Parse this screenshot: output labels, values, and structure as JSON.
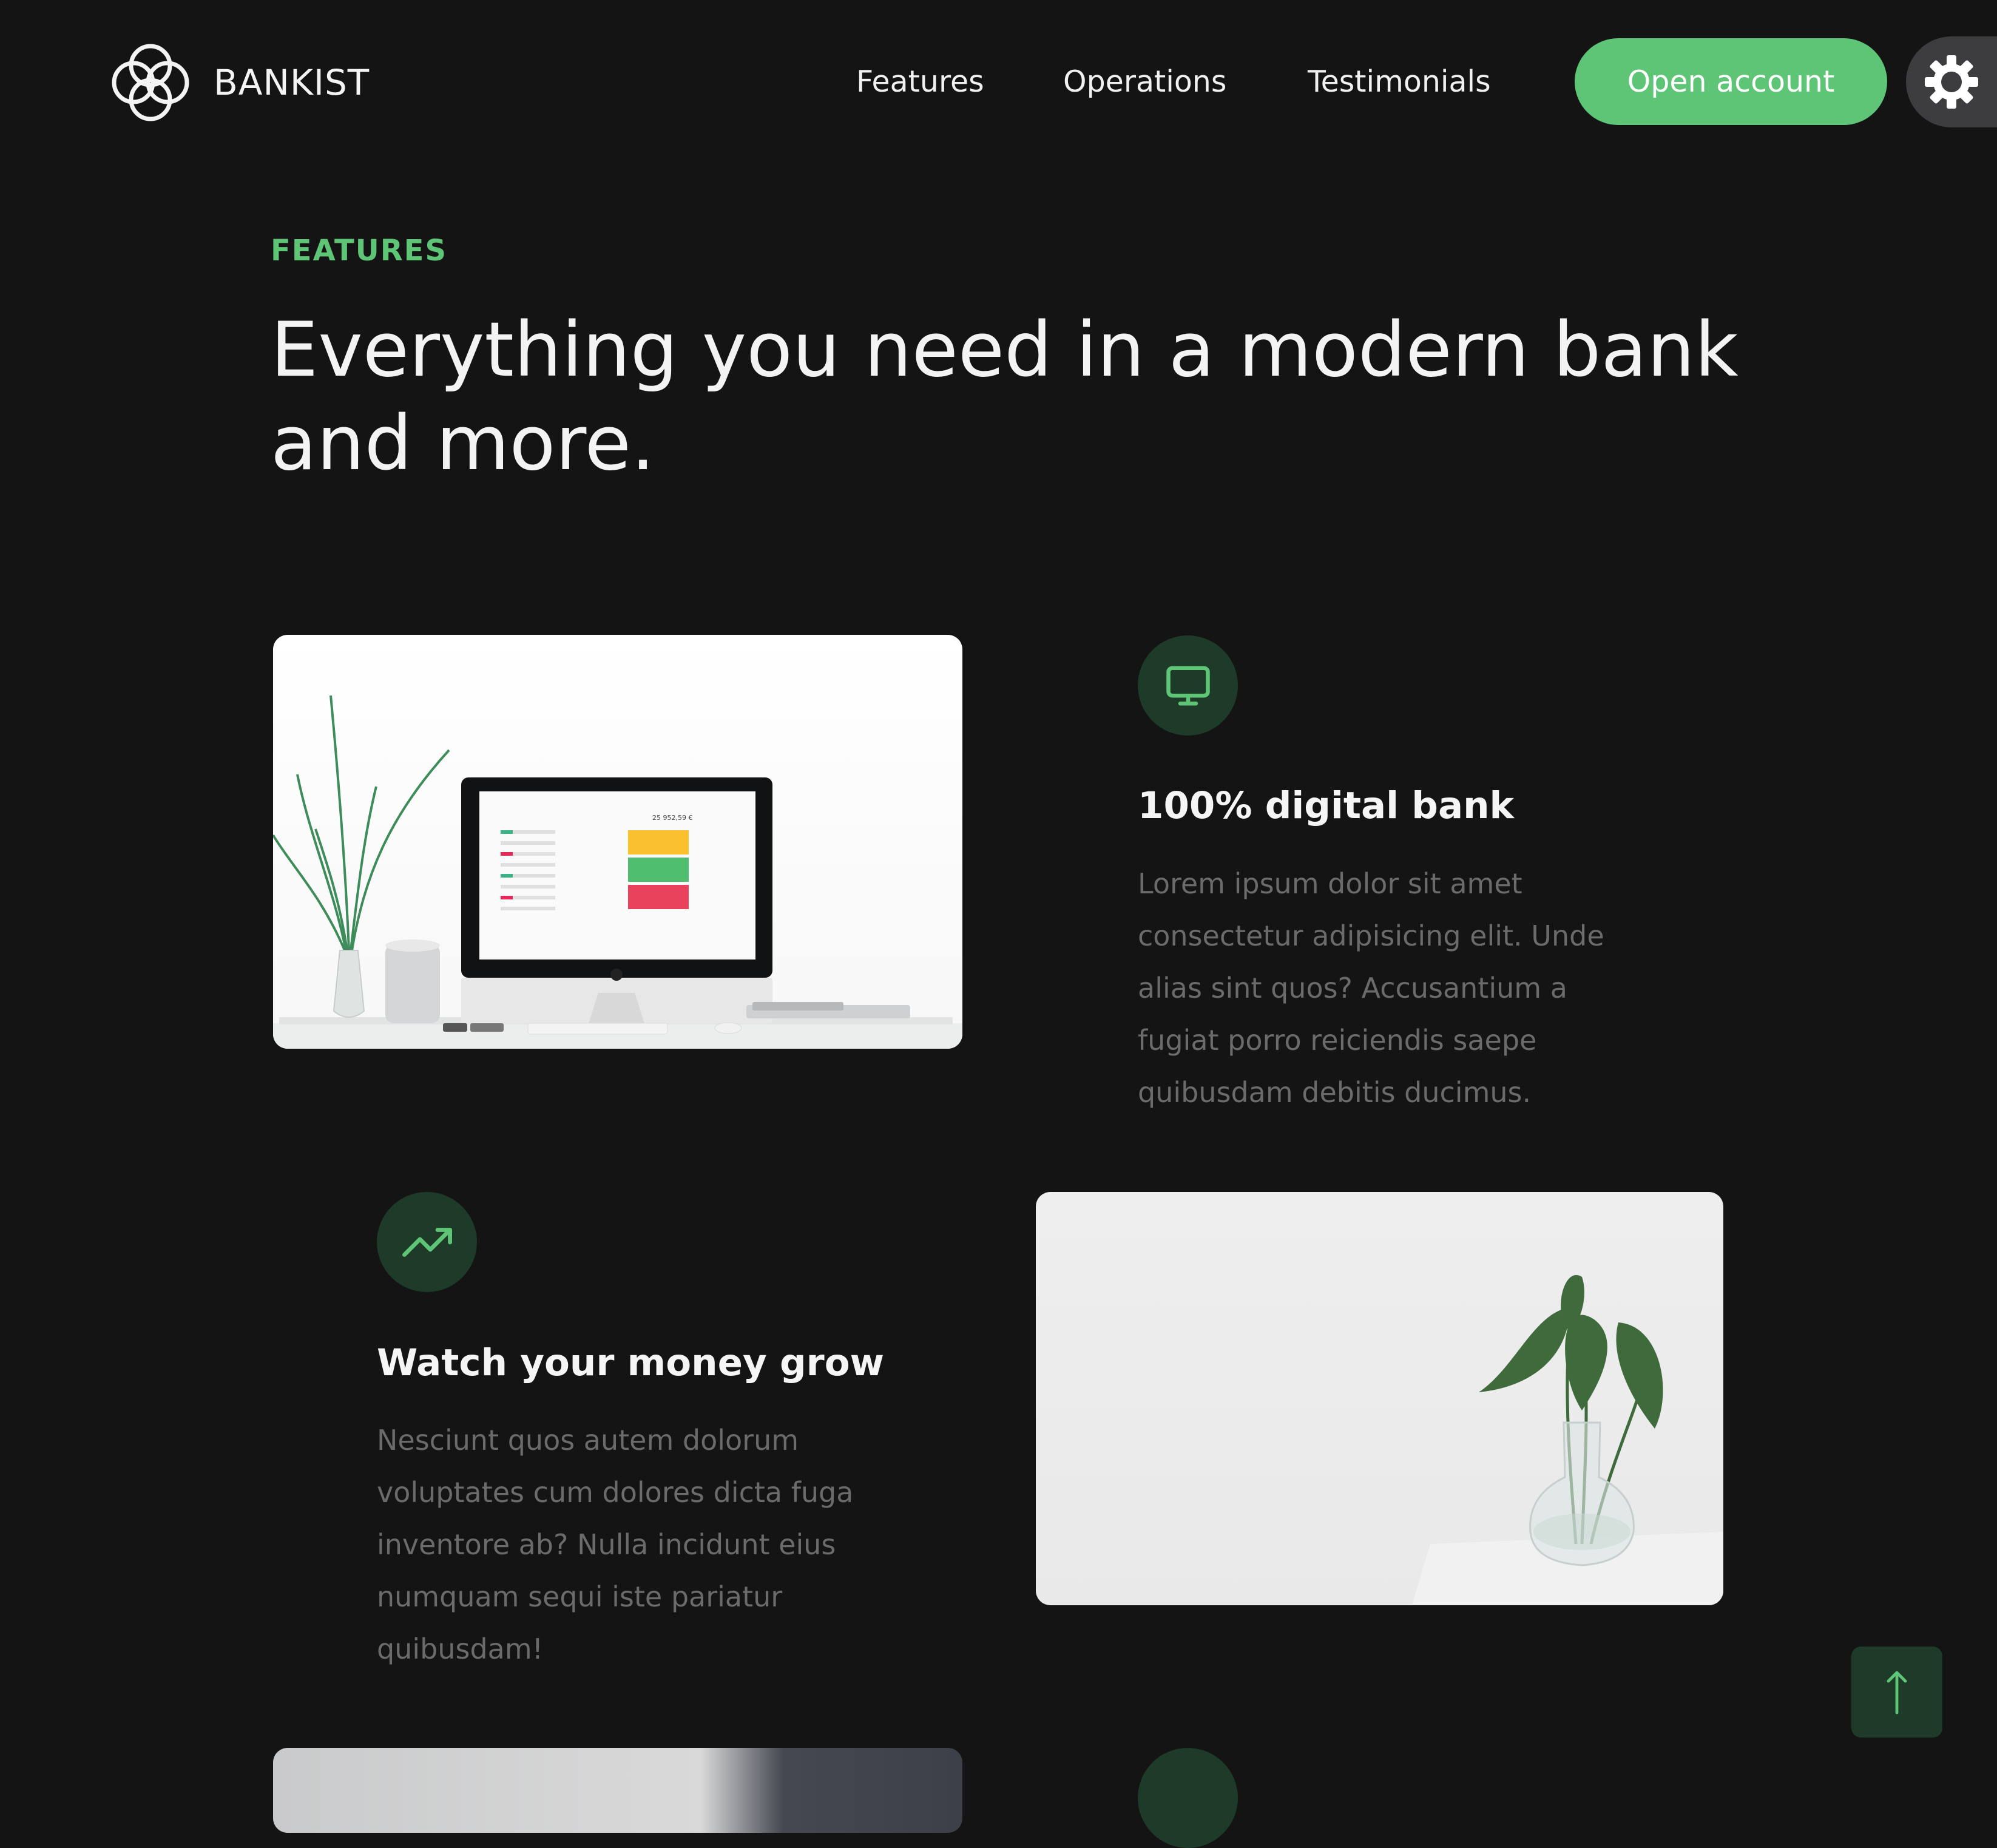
{
  "header": {
    "brand": "BANKIST",
    "nav": [
      {
        "label": "Features"
      },
      {
        "label": "Operations"
      },
      {
        "label": "Testimonials"
      }
    ],
    "cta_label": "Open account",
    "theme_toggle_icon": "gear-icon"
  },
  "section": {
    "eyebrow": "FEATURES",
    "headline": "Everything you need in a modern bank and more."
  },
  "features": [
    {
      "icon": "monitor-icon",
      "title": "100% digital bank",
      "text": "Lorem ipsum dolor sit amet consectetur adipisicing elit. Unde alias sint quos? Accusantium a fugiat porro reiciendis saepe quibusdam debitis ducimus.",
      "image_balance": "25 952,59 €"
    },
    {
      "icon": "trending-up-icon",
      "title": "Watch your money grow",
      "text": "Nesciunt quos autem dolorum voluptates cum dolores dicta fuga inventore ab? Nulla incidunt eius numquam sequi iste pariatur quibusdam!"
    }
  ],
  "colors": {
    "background": "#141415",
    "accent": "#5ec576",
    "icon_bg": "#1e3a28",
    "muted_text": "#6b6b6b"
  },
  "scroll_top": {
    "icon": "arrow-up-icon"
  }
}
